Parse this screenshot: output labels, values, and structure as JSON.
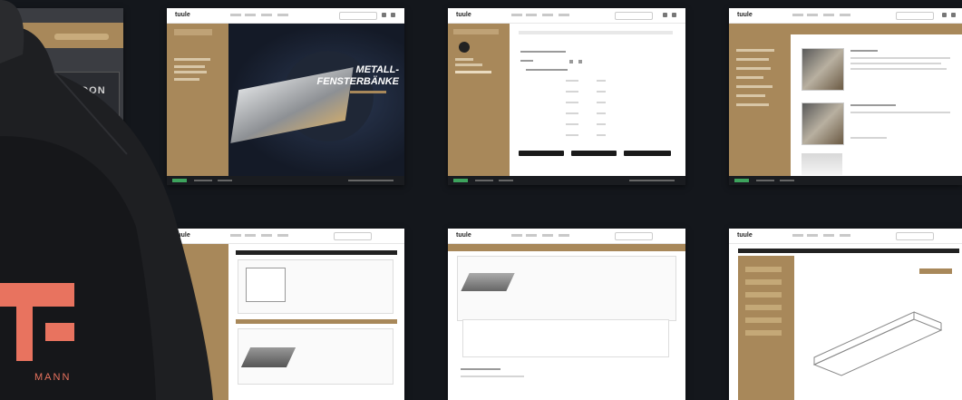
{
  "brand": {
    "logo_text": "tuule",
    "accent": "#a8885a",
    "background": "#14171c",
    "person_logo_color": "#e8735f"
  },
  "hero": {
    "title_line1": "METALL-",
    "title_line2": "FENSTERBÄNKE"
  },
  "coming_soon": {
    "text": "COMING SOON"
  },
  "jacket": {
    "brand_text": "MANN"
  }
}
